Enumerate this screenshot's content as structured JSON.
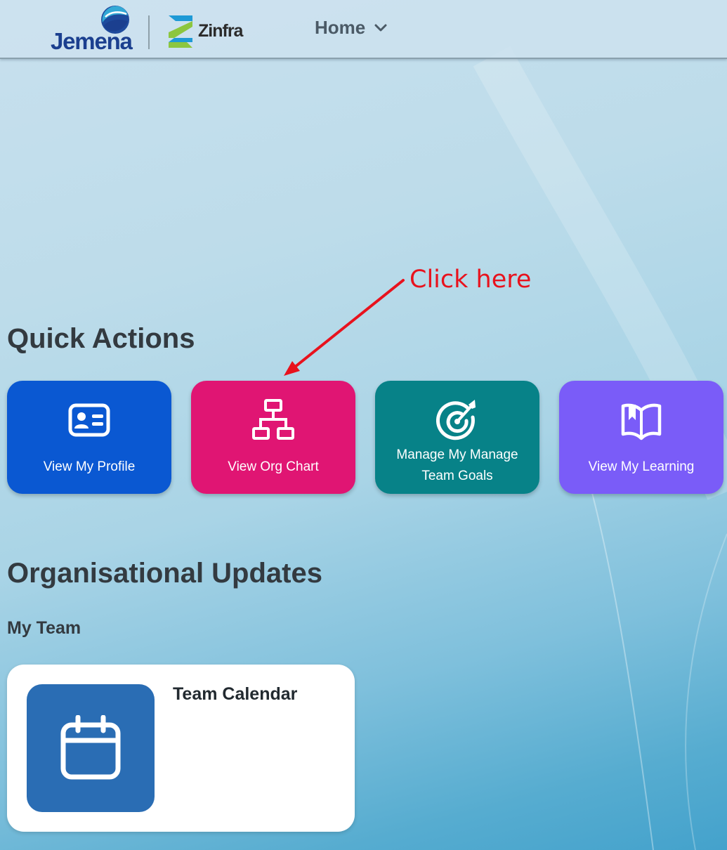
{
  "header": {
    "logo_primary": "Jemena",
    "logo_secondary": "Zinfra",
    "nav_menu_label": "Home"
  },
  "annotation": {
    "text": "Click here",
    "color": "#e8121d"
  },
  "quick_actions": {
    "title": "Quick Actions",
    "tiles": [
      {
        "label": "View My Profile",
        "icon": "profile-card-icon",
        "color": "#0a58d2"
      },
      {
        "label": "View Org Chart",
        "icon": "org-chart-icon",
        "color": "#e01573"
      },
      {
        "label_line1": "Manage My Manage",
        "label_line2": "Team Goals",
        "icon": "target-icon",
        "color": "#078288"
      },
      {
        "label": "View My Learning",
        "icon": "open-book-icon",
        "color": "#7a5cf8"
      }
    ]
  },
  "org_updates": {
    "title": "Organisational Updates",
    "subtitle": "My Team",
    "card": {
      "title": "Team Calendar",
      "icon": "calendar-icon",
      "color": "#2a6db4"
    }
  }
}
